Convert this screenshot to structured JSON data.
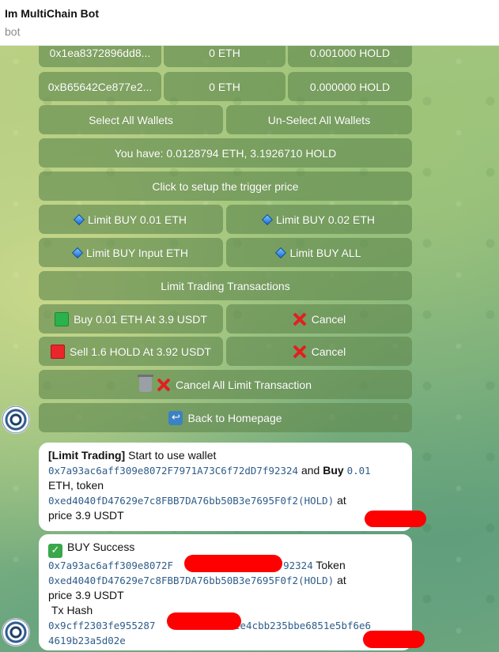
{
  "header": {
    "title": "Im MultiChain Bot",
    "subtitle": "bot"
  },
  "keyboard": {
    "wallet_rows": [
      {
        "address": "0x1ea8372896dd8...",
        "eth": "0 ETH",
        "hold": "0.001000 HOLD"
      },
      {
        "address": "0xB65642Ce877e2...",
        "eth": "0 ETH",
        "hold": "0.000000 HOLD"
      }
    ],
    "select_all": "Select All Wallets",
    "unselect_all": "Un-Select All Wallets",
    "balance": "You have: 0.0128794 ETH, 3.1926710 HOLD",
    "trigger": "Click to setup the trigger price",
    "limit_buy_001": "Limit BUY 0.01 ETH",
    "limit_buy_002": "Limit BUY 0.02 ETH",
    "limit_buy_input": "Limit BUY Input ETH",
    "limit_buy_all": "Limit BUY ALL",
    "limit_transactions": "Limit Trading Transactions",
    "buy_order": "Buy 0.01 ETH At 3.9 USDT",
    "sell_order": "Sell 1.6 HOLD At 3.92 USDT",
    "cancel": "Cancel",
    "cancel_all": "Cancel All Limit Transaction",
    "back": "Back to Homepage"
  },
  "messages": {
    "m1": {
      "tag": "[Limit Trading]",
      "t1": " Start to use wallet",
      "wallet": "0x7a93ac6aff309e8072F7971A73C6f72dD7f92324",
      "and": " and ",
      "buy": "Buy",
      "amount": "0.01",
      "t2": "ETH, token",
      "token": "0xed4040fD47629e7c8FBB7DA76bb50B3e7695F0f2(HOLD)",
      "at": " at",
      "price": "price 3.9 USDT"
    },
    "m2": {
      "status": "BUY Success",
      "wallet_a": "0x7a93ac6aff309e8072F",
      "wallet_b": "7f92324",
      "token_label": " Token",
      "token": "0xed4040fD47629e7c8FBB7DA76bb50B3e7695F0f2(HOLD)",
      "at": " at",
      "price": "price 3.9 USDT",
      "tx_label": "Tx Hash",
      "hash_a": "0x9cff2303fe955287",
      "hash_b": "32e4cbb235bbe6851e5bf6e6",
      "hash_c": "4619b23a5d02e"
    }
  },
  "colors": {
    "redaction": "#ff0000",
    "button_bg": "#60874e"
  }
}
